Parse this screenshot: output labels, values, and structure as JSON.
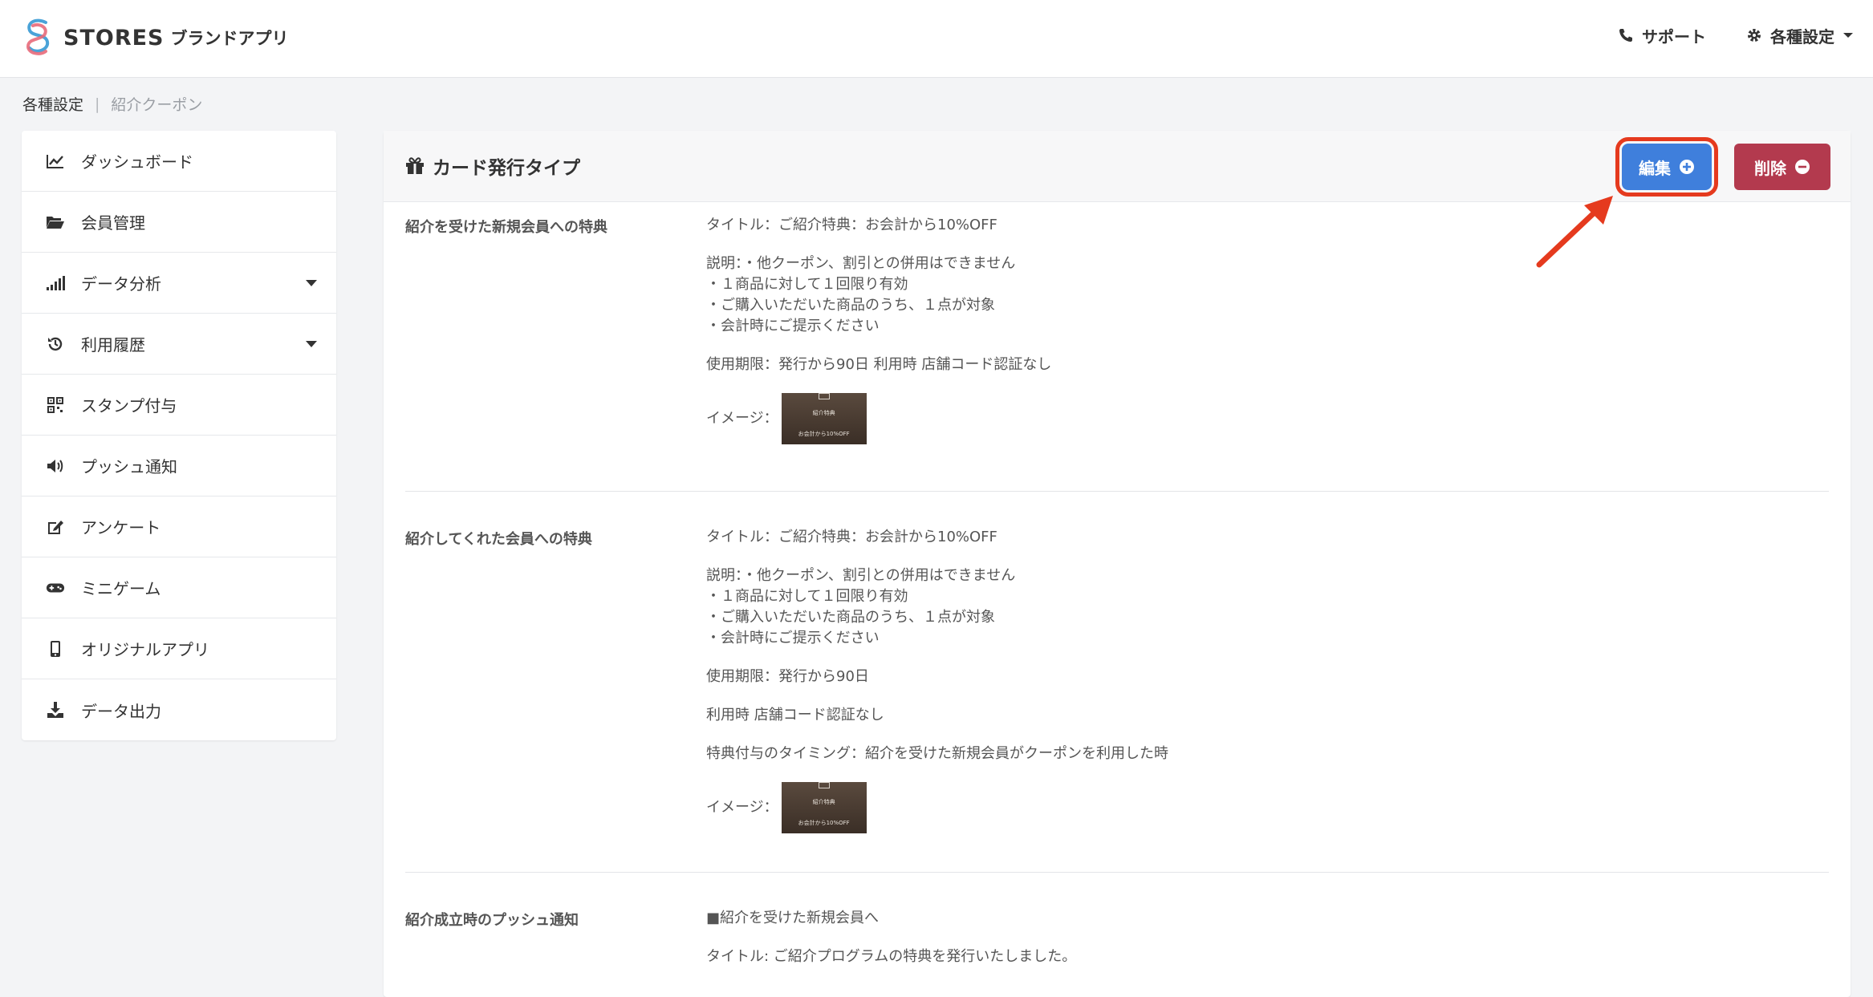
{
  "header": {
    "logo_text": "STORES",
    "logo_sub": "ブランドアプリ",
    "support_label": "サポート",
    "settings_label": "各種設定"
  },
  "breadcrumb": {
    "parent": "各種設定",
    "separator": "|",
    "current": "紹介クーポン"
  },
  "sidebar": {
    "items": [
      {
        "label": "ダッシュボード",
        "icon": "chart-line-icon"
      },
      {
        "label": "会員管理",
        "icon": "folder-open-icon"
      },
      {
        "label": "データ分析",
        "icon": "signal-bars-icon",
        "has_caret": true
      },
      {
        "label": "利用履歴",
        "icon": "history-icon",
        "has_caret": true
      },
      {
        "label": "スタンプ付与",
        "icon": "qrcode-icon"
      },
      {
        "label": "プッシュ通知",
        "icon": "megaphone-icon"
      },
      {
        "label": "アンケート",
        "icon": "edit-icon"
      },
      {
        "label": "ミニゲーム",
        "icon": "gamepad-icon"
      },
      {
        "label": "オリジナルアプリ",
        "icon": "mobile-icon"
      },
      {
        "label": "データ出力",
        "icon": "download-icon"
      }
    ]
  },
  "card": {
    "title": "カード発行タイプ",
    "edit_label": "編集",
    "delete_label": "削除",
    "sections": [
      {
        "label": "紹介を受けた新規会員への特典",
        "title_line": "タイトル：ご紹介特典：お会計から10%OFF",
        "desc_lines": [
          "説明：・他クーポン、割引との併用はできません",
          "・１商品に対して１回限り有効",
          "・ご購入いただいた商品のうち、１点が対象",
          "・会計時にご提示ください"
        ],
        "period_line": "使用期限：発行から90日 利用時 店舗コード認証なし",
        "image_label": "イメージ：",
        "thumb_line1": "紹介特典",
        "thumb_line2": "お会計から10%OFF"
      },
      {
        "label": "紹介してくれた会員への特典",
        "title_line": "タイトル：ご紹介特典：お会計から10%OFF",
        "desc_lines": [
          "説明：・他クーポン、割引との併用はできません",
          "・１商品に対して１回限り有効",
          "・ご購入いただいた商品のうち、１点が対象",
          "・会計時にご提示ください"
        ],
        "period_line": "使用期限：発行から90日",
        "auth_line": "利用時 店舗コード認証なし",
        "timing_line": "特典付与のタイミング：紹介を受けた新規会員がクーポンを利用した時",
        "image_label": "イメージ：",
        "thumb_line1": "紹介特典",
        "thumb_line2": "お会計から10%OFF"
      },
      {
        "label": "紹介成立時のプッシュ通知",
        "target_line": "■紹介を受けた新規会員へ",
        "title_line": "タイトル: ご紹介プログラムの特典を発行いたしました。"
      }
    ]
  },
  "colors": {
    "edit_button": "#3f7fdc",
    "delete_button": "#b33a4e",
    "highlight": "#e53a1e"
  }
}
